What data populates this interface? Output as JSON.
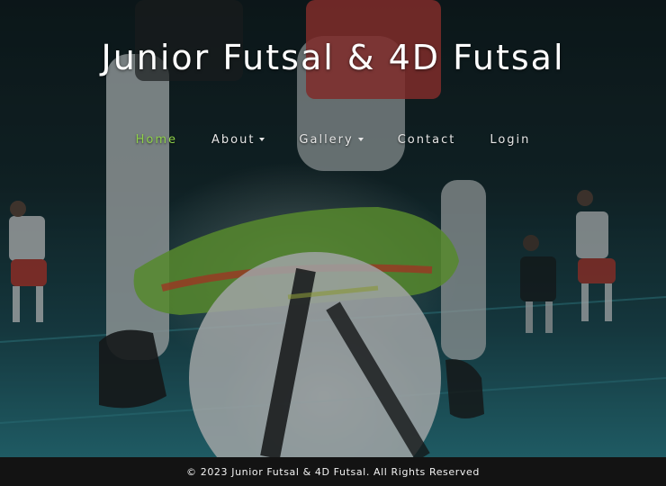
{
  "site": {
    "title": "Junior Futsal & 4D Futsal"
  },
  "nav": {
    "items": [
      {
        "label": "Home",
        "active": true,
        "dropdown": false
      },
      {
        "label": "About",
        "active": false,
        "dropdown": true
      },
      {
        "label": "Gallery",
        "active": false,
        "dropdown": true
      },
      {
        "label": "Contact",
        "active": false,
        "dropdown": false
      },
      {
        "label": "Login",
        "active": false,
        "dropdown": false
      }
    ],
    "active_color": "#8fd24a",
    "text_color": "#e6e6e6"
  },
  "hero": {
    "image": "futsal-players-background-photo"
  },
  "footer": {
    "text": "© 2023 Junior Futsal & 4D Futsal. All Rights Reserved",
    "background": "#131313"
  }
}
